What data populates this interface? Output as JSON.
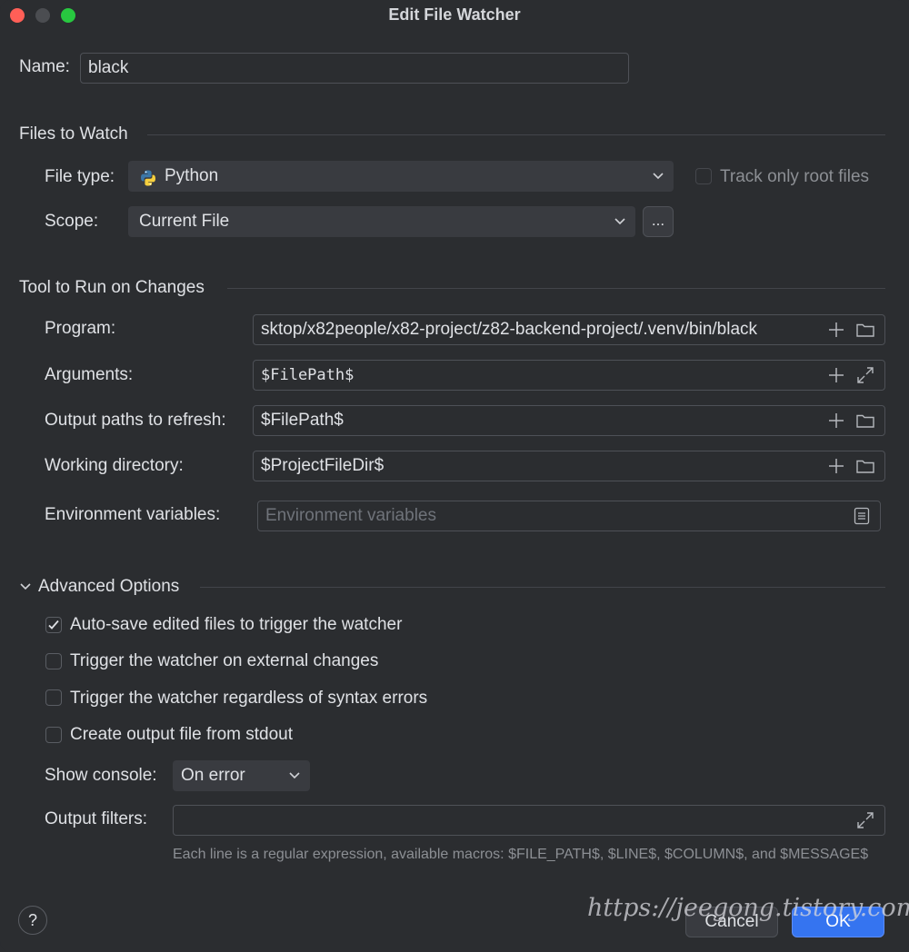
{
  "dialog": {
    "title": "Edit File Watcher"
  },
  "name": {
    "label": "Name:",
    "value": "black"
  },
  "files_to_watch": {
    "heading": "Files to Watch",
    "file_type_label": "File type:",
    "file_type_value": "Python",
    "track_root_label": "Track only root files",
    "track_root_checked": false,
    "scope_label": "Scope:",
    "scope_value": "Current File",
    "scope_more": "..."
  },
  "tool": {
    "heading": "Tool to Run on Changes",
    "program_label": "Program:",
    "program_value": "sktop/x82people/x82-project/z82-backend-project/.venv/bin/black",
    "arguments_label": "Arguments:",
    "arguments_value": "$FilePath$",
    "output_paths_label": "Output paths to refresh:",
    "output_paths_value": "$FilePath$",
    "working_dir_label": "Working directory:",
    "working_dir_value": "$ProjectFileDir$",
    "env_label": "Environment variables:",
    "env_placeholder": "Environment variables"
  },
  "advanced": {
    "heading": "Advanced Options",
    "options": [
      {
        "label": "Auto-save edited files to trigger the watcher",
        "checked": true
      },
      {
        "label": "Trigger the watcher on external changes",
        "checked": false
      },
      {
        "label": "Trigger the watcher regardless of syntax errors",
        "checked": false
      },
      {
        "label": "Create output file from stdout",
        "checked": false
      }
    ],
    "show_console_label": "Show console:",
    "show_console_value": "On error",
    "output_filters_label": "Output filters:",
    "output_filters_value": "",
    "hint": "Each line is a regular expression, available macros: $FILE_PATH$, $LINE$, $COLUMN$, and $MESSAGE$"
  },
  "footer": {
    "help": "?",
    "cancel": "Cancel",
    "ok": "OK",
    "watermark": "https://jeegong.tistory.com"
  },
  "colors": {
    "accent": "#3574f0",
    "background": "#2b2d30",
    "field_bg": "#393b40"
  }
}
